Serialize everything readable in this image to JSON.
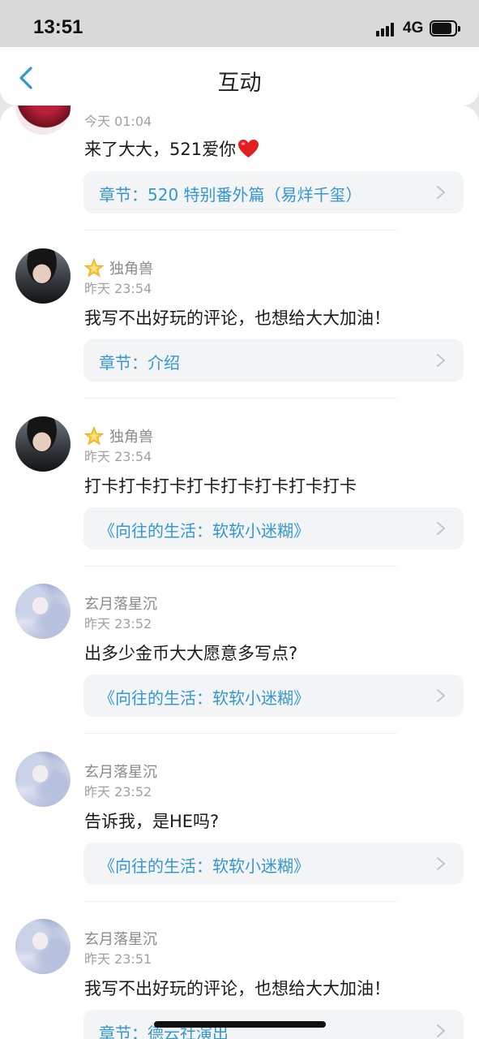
{
  "status_bar": {
    "time": "13:51",
    "network": "4G"
  },
  "nav": {
    "title": "互动"
  },
  "comments": [
    {
      "username": "",
      "badge": "",
      "time": "今天 01:04",
      "text": "来了大大，521爱你",
      "ref": "章节：520 特别番外篇（易烊千玺）"
    },
    {
      "username": "独角兽",
      "badge": "star-icon",
      "time": "昨天 23:54",
      "text": "我写不出好玩的评论，也想给大大加油！",
      "ref": "章节：介绍"
    },
    {
      "username": "独角兽",
      "badge": "star-icon",
      "time": "昨天 23:54",
      "text": "打卡打卡打卡打卡打卡打卡打卡打卡",
      "ref": "《向往的生活：软软小迷糊》"
    },
    {
      "username": "玄月落星沉",
      "badge": "",
      "time": "昨天 23:52",
      "text": "出多少金币大大愿意多写点?",
      "ref": "《向往的生活：软软小迷糊》"
    },
    {
      "username": "玄月落星沉",
      "badge": "",
      "time": "昨天 23:52",
      "text": "告诉我，是HE吗?",
      "ref": "《向往的生活：软软小迷糊》"
    },
    {
      "username": "玄月落星沉",
      "badge": "",
      "time": "昨天 23:51",
      "text": "我写不出好玩的评论，也想给大大加油！",
      "ref": "章节：德云社演出"
    }
  ],
  "colors": {
    "accent": "#3496d3",
    "ref_bg": "#f3f4f6",
    "heart": "#e02020"
  }
}
